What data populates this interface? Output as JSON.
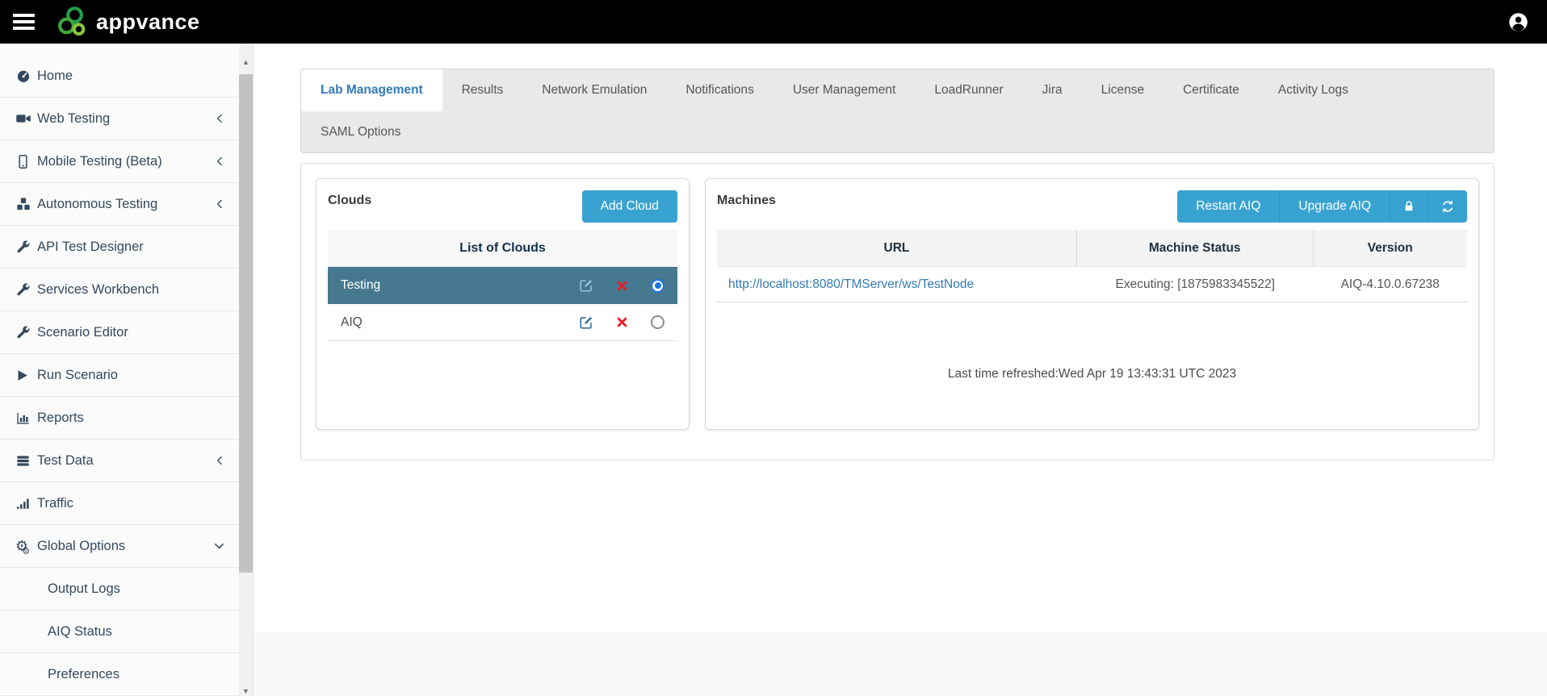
{
  "header": {
    "brand": "appvance",
    "menu_icon": "hamburger-icon",
    "user_icon": "user-account-icon"
  },
  "sidebar": {
    "items": [
      {
        "label": "Home",
        "icon": "gauge-icon"
      },
      {
        "label": "Web Testing",
        "icon": "video-camera-icon",
        "chevron": "left"
      },
      {
        "label": "Mobile Testing (Beta)",
        "icon": "mobile-icon",
        "chevron": "left"
      },
      {
        "label": "Autonomous Testing",
        "icon": "cubes-icon",
        "chevron": "left"
      },
      {
        "label": "API Test Designer",
        "icon": "wrench-icon"
      },
      {
        "label": "Services Workbench",
        "icon": "wrench-icon"
      },
      {
        "label": "Scenario Editor",
        "icon": "wrench-icon"
      },
      {
        "label": "Run Scenario",
        "icon": "play-icon"
      },
      {
        "label": "Reports",
        "icon": "bar-chart-icon"
      },
      {
        "label": "Test Data",
        "icon": "stack-icon",
        "chevron": "left"
      },
      {
        "label": "Traffic",
        "icon": "signal-icon"
      },
      {
        "label": "Global Options",
        "icon": "gears-icon",
        "chevron": "down"
      },
      {
        "label": "Output Logs",
        "indent": true
      },
      {
        "label": "AIQ Status",
        "indent": true
      },
      {
        "label": "Preferences",
        "indent": true
      }
    ]
  },
  "tabs": {
    "active": "Lab Management",
    "row1": [
      "Lab Management",
      "Results",
      "Network Emulation",
      "Notifications",
      "User Management",
      "LoadRunner",
      "Jira",
      "License",
      "Certificate",
      "Activity Logs"
    ],
    "row2": [
      "SAML Options"
    ]
  },
  "clouds": {
    "title": "Clouds",
    "add_button": "Add Cloud",
    "list_header": "List of Clouds",
    "rows": [
      {
        "name": "Testing",
        "selected": true
      },
      {
        "name": "AIQ",
        "selected": false
      }
    ]
  },
  "machines": {
    "title": "Machines",
    "restart_button": "Restart AIQ",
    "upgrade_button": "Upgrade AIQ",
    "lock_icon": "lock-icon",
    "refresh_icon": "refresh-icon",
    "columns": [
      "URL",
      "Machine Status",
      "Version"
    ],
    "rows": [
      {
        "url": "http://localhost:8080/TMServer/ws/TestNode",
        "status": "Executing: [1875983345522]",
        "version": "AIQ-4.10.0.67238"
      }
    ],
    "refreshed_text": "Last time refreshed:Wed Apr 19 13:43:31 UTC 2023"
  },
  "colors": {
    "topbar_black": "#000000",
    "accent_blue": "#38a3d1",
    "selected_row_teal": "#46798f",
    "link_blue": "#337ab7",
    "active_tab_blue": "#337ab7",
    "danger_red": "#e3202a",
    "sidebar_text": "#33485c",
    "logo_green_dark": "#239e49",
    "logo_green_mid": "#3fa73c",
    "logo_green_light": "#8cc63e"
  }
}
